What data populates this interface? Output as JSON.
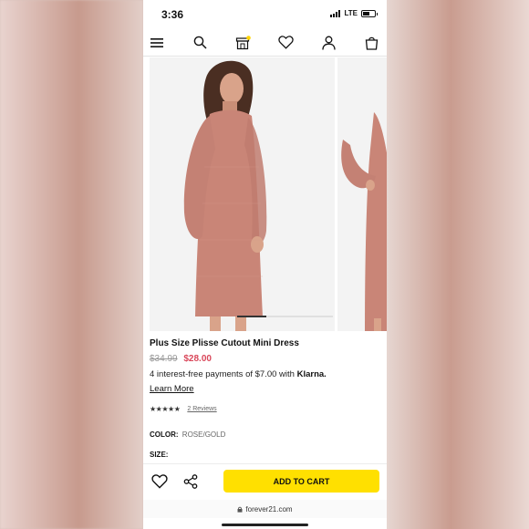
{
  "status": {
    "time": "3:36",
    "network": "LTE"
  },
  "nav": {
    "icons": [
      "menu-icon",
      "search-icon",
      "store-icon",
      "heart-icon",
      "account-icon",
      "bag-icon"
    ],
    "badge_color": "#ffd400"
  },
  "carousel": {
    "slide_count_visible": 2,
    "progress": 0.3
  },
  "product": {
    "title": "Plus Size Plisse Cutout Mini Dress",
    "old_price": "$34.99",
    "new_price": "$28.00",
    "installments_text": "4 interest-free payments of $7.00 with ",
    "klarna": "Klarna.",
    "learn_more": "Learn More",
    "stars": "★★★★★",
    "rating": 4.5,
    "reviews": "2 Reviews",
    "color_label": "COLOR:",
    "color_value": "ROSE/GOLD",
    "size_label": "SIZE:"
  },
  "actions": {
    "add_to_cart": "ADD TO CART"
  },
  "browser": {
    "url": "forever21.com"
  },
  "colors": {
    "accent": "#ffe000",
    "sale_price": "#d9475a",
    "dress": "#c98577"
  }
}
